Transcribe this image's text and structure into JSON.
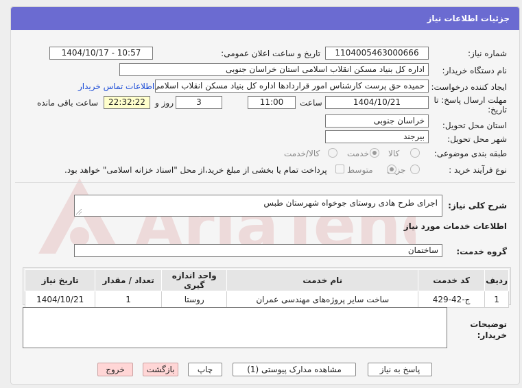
{
  "header": {
    "title": "جزئیات اطلاعات نیاز"
  },
  "fields": {
    "need_number": {
      "label": "شماره نیاز:",
      "value": "1104005463000666"
    },
    "announce_datetime": {
      "label": "تاریخ و ساعت اعلان عمومی:",
      "value": "1404/10/17 - 10:57"
    },
    "buyer_org": {
      "label": "نام دستگاه خریدار:",
      "value": "اداره کل بنیاد مسکن انقلاب اسلامی استان خراسان جنوبی"
    },
    "requester": {
      "label": "ایجاد کننده درخواست:",
      "value": "حمیده حق پرست کارشناس امور قراردادها اداره کل بنیاد مسکن انقلاب اسلامی"
    },
    "contact_link": "اطلاعات تماس خریدار",
    "deadline": {
      "label_line1": "مهلت ارسال پاسخ: تا",
      "label_line2": "تاریخ:",
      "date": "1404/10/21",
      "time_label": "ساعت",
      "time": "11:00",
      "days": "3",
      "days_label": "روز و",
      "remaining": "22:32:22",
      "remaining_label": "ساعت باقی مانده"
    },
    "province": {
      "label": "استان محل تحویل:",
      "value": "خراسان جنوبی"
    },
    "city": {
      "label": "شهر محل تحویل:",
      "value": "بیرجند"
    }
  },
  "category": {
    "label": "طبقه بندی موضوعی:",
    "options": [
      "کالا",
      "خدمت",
      "کالا/خدمت"
    ],
    "selected": "خدمت"
  },
  "purchase_type": {
    "label": "نوع فرآیند خرید :",
    "options": [
      "جزیی",
      "متوسط"
    ],
    "selected": "متوسط",
    "treasury_note": "پرداخت تمام یا بخشی از مبلغ خرید،از محل \"اسناد خزانه اسلامی\" خواهد بود."
  },
  "description": {
    "label": "شرح کلی نیاز:",
    "value": "اجرای طرح هادی روستای جوخواه شهرستان طبس"
  },
  "services_section": {
    "title": "اطلاعات خدمات مورد نیاز"
  },
  "service_group": {
    "label": "گروه خدمت:",
    "value": "ساختمان"
  },
  "table": {
    "headers": [
      "ردیف",
      "کد خدمت",
      "نام خدمت",
      "واحد اندازه گیری",
      "تعداد / مقدار",
      "تاریخ نیاز"
    ],
    "rows": [
      [
        "1",
        "ج-42-429",
        "ساخت سایر پروژه‌های مهندسی عمران",
        "روستا",
        "1",
        "1404/10/21"
      ]
    ]
  },
  "buyer_notes": {
    "label_line1": "توضیحات",
    "label_line2": "خریدار:",
    "value": ""
  },
  "buttons": {
    "reply": "پاسخ به نیاز",
    "attachments": "مشاهده مدارک پیوستی (1)",
    "print": "چاپ",
    "back": "بازگشت",
    "exit": "خروج"
  },
  "watermark": "AriaTender.net",
  "colors": {
    "header": "#6b6bd1",
    "link": "#1a4bd6",
    "highlight": "#ffffcc",
    "danger_button": "#ffd6d6"
  }
}
